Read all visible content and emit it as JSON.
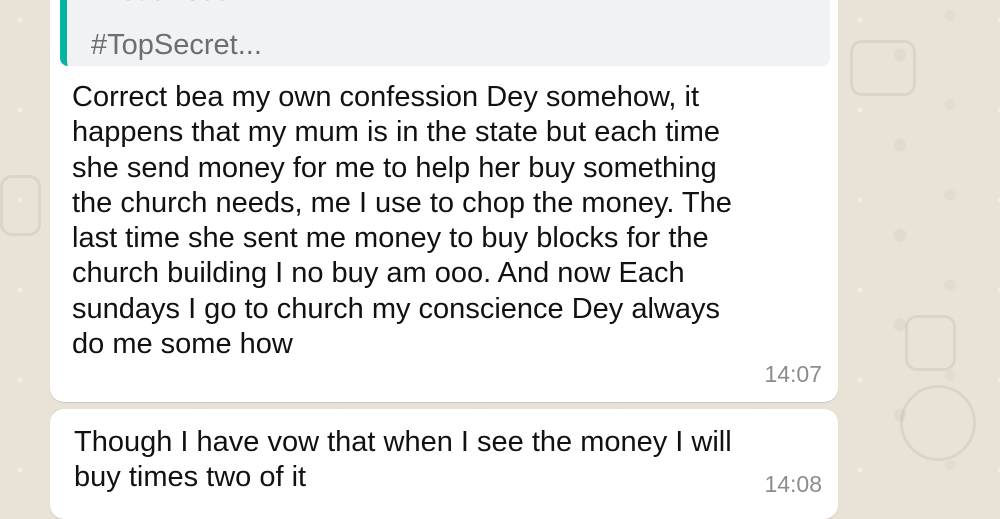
{
  "chat": {
    "background_color": "#e9e2d7",
    "accent_color": "#06b5a0",
    "quoted_message": {
      "line1": "Breath out",
      "line2": "#TopSecret..."
    },
    "messages": [
      {
        "text": "Correct bea my own confession Dey somehow, it\nhappens that my mum is in the state but each time\nshe send money for me to help her buy something\nthe church needs, me I use to chop the money. The\nlast time she sent me money to buy blocks for the\nchurch building I no buy am ooo. And now Each\nsundays I go to church my conscience Dey always\ndo me some how",
        "time": "14:07"
      },
      {
        "text": "Though I have vow that when I see the money I will\nbuy times two of it",
        "time": "14:08"
      }
    ]
  }
}
